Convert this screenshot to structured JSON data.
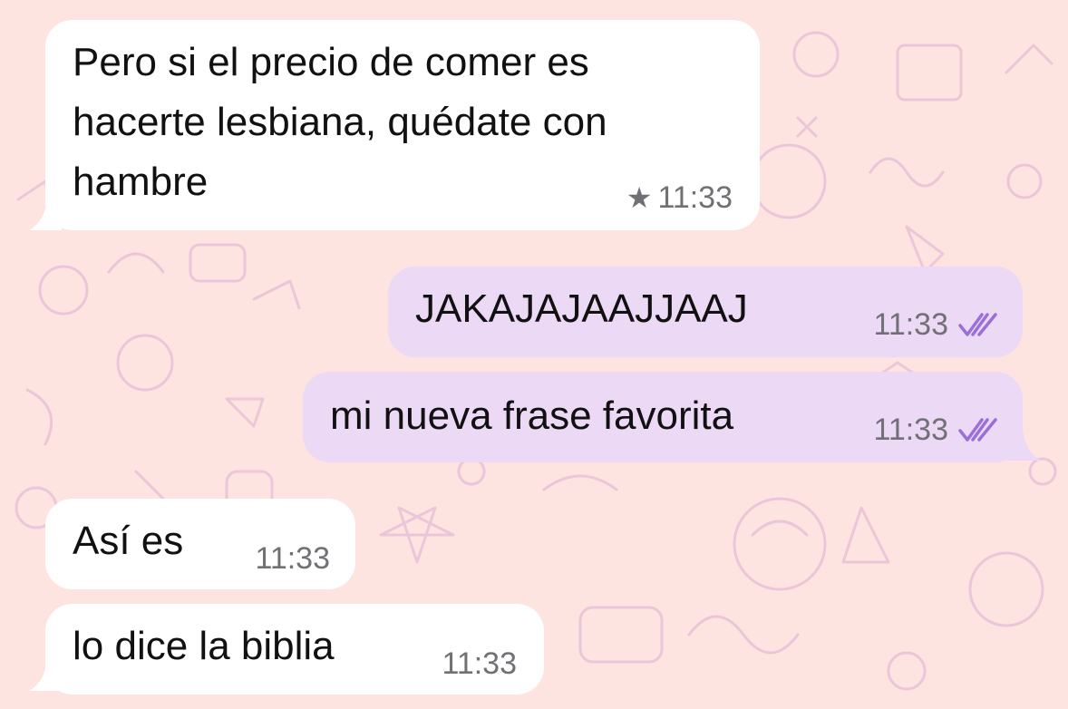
{
  "theme": {
    "background": "#fde4e0",
    "incoming_bubble": "#ffffff",
    "outgoing_bubble": "#ecd9f5",
    "read_receipt_color": "#9b6fd8",
    "timestamp_color": "#717075"
  },
  "messages": [
    {
      "direction": "incoming",
      "lines": [
        "Pero si el precio de comer es",
        "hacerte lesbiana, quédate con",
        "hambre"
      ],
      "time": "11:33",
      "starred": true,
      "star_icon": "star-icon"
    },
    {
      "direction": "outgoing",
      "text": "JAKAJAJAAJJAAJ",
      "time": "11:33",
      "status_icon": "double-check-icon"
    },
    {
      "direction": "outgoing",
      "text": "mi nueva frase favorita",
      "time": "11:33",
      "status_icon": "double-check-icon"
    },
    {
      "direction": "incoming",
      "text": "Así es",
      "time": "11:33"
    },
    {
      "direction": "incoming",
      "text": "lo dice la biblia",
      "time": "11:33"
    }
  ]
}
